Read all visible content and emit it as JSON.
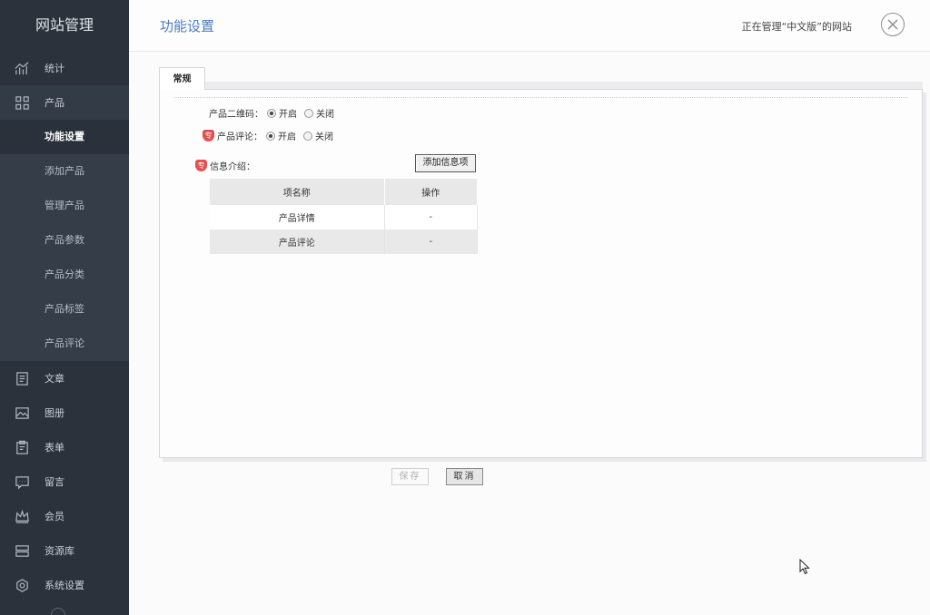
{
  "sidebar": {
    "brand": "网站管理",
    "items": [
      {
        "label": "统计",
        "icon": "chart-icon"
      },
      {
        "label": "产品",
        "icon": "grid-icon"
      },
      {
        "label": "文章",
        "icon": "article-icon"
      },
      {
        "label": "图册",
        "icon": "image-icon"
      },
      {
        "label": "表单",
        "icon": "form-icon"
      },
      {
        "label": "留言",
        "icon": "message-icon"
      },
      {
        "label": "会员",
        "icon": "crown-icon"
      },
      {
        "label": "资源库",
        "icon": "database-icon"
      },
      {
        "label": "系统设置",
        "icon": "settings-icon"
      }
    ],
    "product_sub": [
      "功能设置",
      "添加产品",
      "管理产品",
      "产品参数",
      "产品分类",
      "产品标签",
      "产品评论"
    ]
  },
  "header": {
    "title": "功能设置",
    "site_info": "正在管理“中文版”的网站"
  },
  "tab": {
    "label": "常规"
  },
  "form": {
    "qr_label": "产品二维码：",
    "review_label": "产品评论：",
    "info_label": "信息介绍：",
    "pro_badge": "专",
    "on": "开启",
    "off": "关闭",
    "add_button": "添加信息项"
  },
  "table": {
    "headers": [
      "项名称",
      "操作"
    ],
    "rows": [
      [
        "产品详情",
        "-"
      ],
      [
        "产品评论",
        "-"
      ]
    ]
  },
  "buttons": {
    "save": "保存",
    "cancel": "取消"
  }
}
